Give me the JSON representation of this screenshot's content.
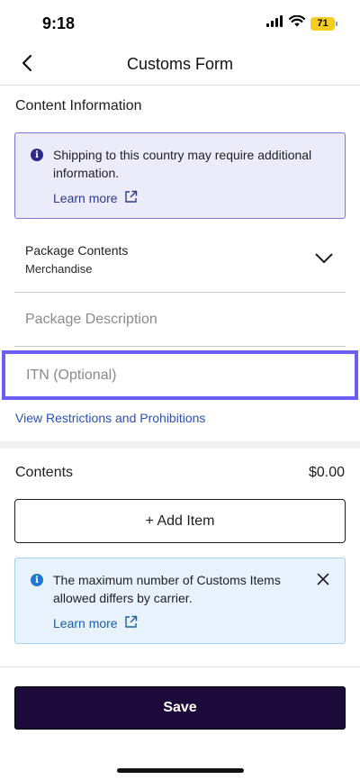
{
  "status_bar": {
    "time": "9:18",
    "battery": "71"
  },
  "header": {
    "title": "Customs Form"
  },
  "content_information": {
    "title": "Content Information",
    "notice": {
      "text": "Shipping to this country may require additional information.",
      "link": "Learn more"
    },
    "package_contents": {
      "label": "Package Contents",
      "value": "Merchandise"
    },
    "package_description": {
      "placeholder": "Package Description",
      "value": ""
    },
    "itn": {
      "placeholder": "ITN (Optional)",
      "value": ""
    },
    "restrictions_link": "View Restrictions and Prohibitions"
  },
  "contents": {
    "title": "Contents",
    "total": "$0.00",
    "add_item_label": "+ Add Item",
    "notice": {
      "text": "The maximum number of Customs Items allowed differs by carrier.",
      "link": "Learn more"
    }
  },
  "footer": {
    "save_label": "Save"
  },
  "colors": {
    "accent_purple": "#6a5ff2",
    "save_button": "#1c0a3a",
    "link": "#2753b8",
    "battery": "#f6cd1c"
  }
}
